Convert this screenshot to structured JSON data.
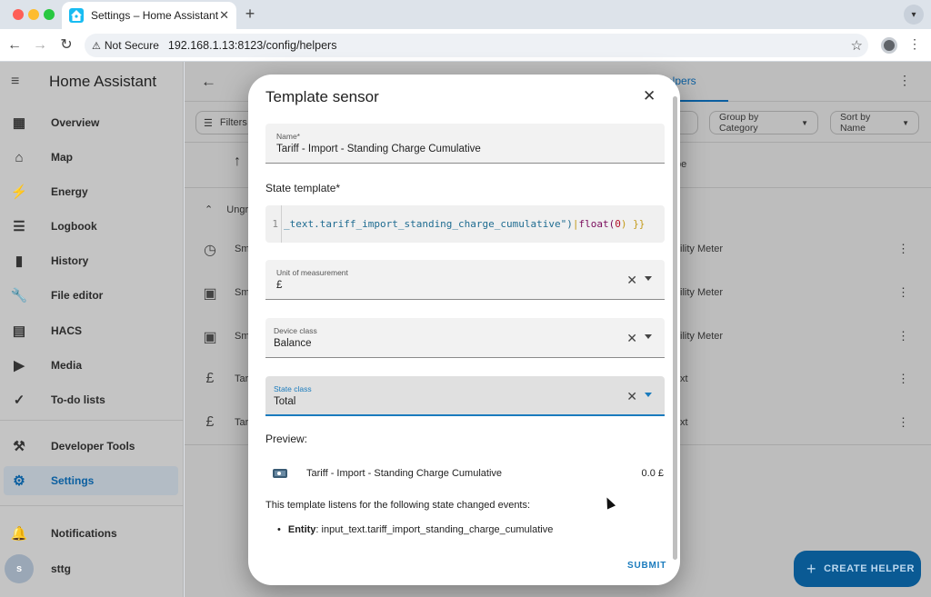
{
  "browser": {
    "tab_title": "Settings – Home Assistant",
    "tab_close": "✕",
    "new_tab": "+",
    "tab_menu": "▾",
    "security_label": "Not Secure",
    "url": "192.168.1.13:8123/config/helpers",
    "icons": {
      "back": "arrow-left-icon",
      "forward": "arrow-right-icon",
      "reload": "reload-icon",
      "bookmark": "star-icon",
      "menu": "kebab-icon"
    }
  },
  "sidebar": {
    "title": "Home Assistant",
    "items": [
      {
        "label": "Overview",
        "icon": "▦"
      },
      {
        "label": "Map",
        "icon": "⌂"
      },
      {
        "label": "Energy",
        "icon": "⚡"
      },
      {
        "label": "Logbook",
        "icon": "☰"
      },
      {
        "label": "History",
        "icon": "▮"
      },
      {
        "label": "File editor",
        "icon": "🔧"
      },
      {
        "label": "HACS",
        "icon": "▤"
      },
      {
        "label": "Media",
        "icon": "▶"
      },
      {
        "label": "To-do lists",
        "icon": "✓"
      },
      {
        "label": "Developer Tools",
        "icon": "⚒"
      },
      {
        "label": "Settings",
        "icon": "⚙"
      },
      {
        "label": "Notifications",
        "icon": "🔔"
      }
    ],
    "active_item": "Settings",
    "user_initial": "s",
    "user_name": "sttg"
  },
  "main": {
    "tab_label": "elpers",
    "filters_label": "Filters",
    "group_label": "Group by Category",
    "sort_label": "Sort by Name",
    "type_col": "pe",
    "group_name": "Ungr",
    "rows": [
      {
        "icon": "◷",
        "name": "Sm",
        "type": "ility Meter"
      },
      {
        "icon": "▣",
        "name": "Sm",
        "type": "ility Meter"
      },
      {
        "icon": "▣",
        "name": "Sm",
        "type": "ility Meter"
      },
      {
        "icon": "£",
        "name": "Tar",
        "type": "xt"
      },
      {
        "icon": "£",
        "name": "Tar",
        "type": "xt"
      }
    ],
    "fab_label": "CREATE HELPER"
  },
  "dialog": {
    "title": "Template sensor",
    "name_label": "Name*",
    "name_value": "Tariff - Import - Standing Charge Cumulative",
    "state_template_label": "State template*",
    "code_line_number": "1",
    "code_string": "_text.tariff_import_standing_charge_cumulative\")",
    "code_pipe": "|",
    "code_func": "float(",
    "code_num": "0",
    "code_close": ") }}",
    "unit_label": "Unit of measurement",
    "unit_value": "£",
    "device_class_label": "Device class",
    "device_class_value": "Balance",
    "state_class_label": "State class",
    "state_class_value": "Total",
    "preview_label": "Preview:",
    "preview_entity": "Tariff - Import - Standing Charge Cumulative",
    "preview_state": "0.0 £",
    "listen_text": "This template listens for the following state changed events:",
    "entity_label": "Entity",
    "entity_value": ": input_text.tariff_import_standing_charge_cumulative",
    "submit_label": "SUBMIT",
    "clear_glyph": "✕",
    "close_glyph": "✕"
  },
  "colors": {
    "accent": "#1a7bbd",
    "fab": "#0a5a94",
    "sidebar_active": "#0b5fa0"
  }
}
